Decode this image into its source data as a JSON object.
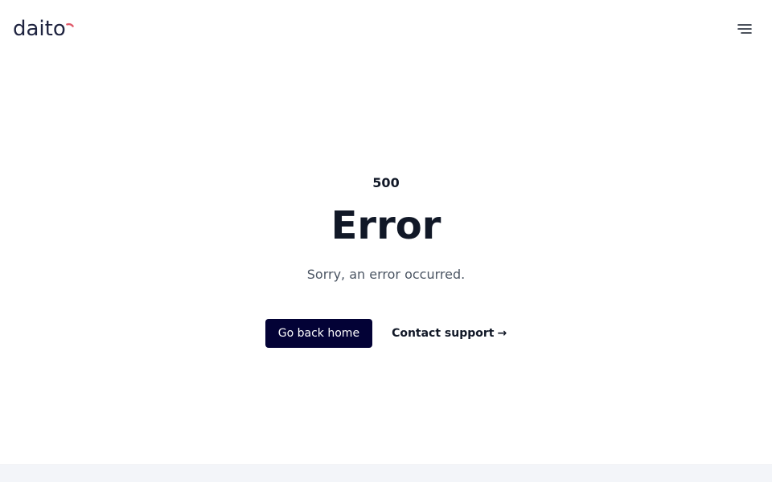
{
  "header": {
    "logo_text": "daito",
    "menu_icon": "hamburger-menu-icon"
  },
  "error": {
    "code": "500",
    "title": "Error",
    "message": "Sorry, an error occurred."
  },
  "actions": {
    "home_label": "Go back home",
    "support_label": "Contact support",
    "support_arrow": "→"
  },
  "colors": {
    "primary_button": "#030236",
    "text_dark": "#111827",
    "text_muted": "#4b5563",
    "logo_accent": "#e05a6a",
    "logo_text": "#1f2440",
    "footer_band": "#f3f5f9"
  }
}
